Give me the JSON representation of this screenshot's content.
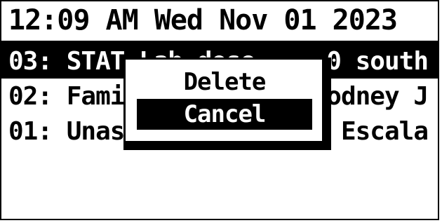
{
  "status": {
    "time": "12:09 AM",
    "date": "Wed Nov 01 2023"
  },
  "rows": [
    {
      "index": "03:",
      "name": "STAT Lab dose",
      "count": "0",
      "right": "south",
      "selected": true
    },
    {
      "index": "02:",
      "name": "Famil",
      "right": "odney J",
      "selected": false
    },
    {
      "index": "01:",
      "name": "Unas",
      "right": "Escala",
      "selected": false
    }
  ],
  "popup": {
    "options": [
      "Delete",
      "Cancel"
    ],
    "highlighted": "Cancel"
  },
  "colors": {
    "foreground": "#000000",
    "background": "#ffffff"
  }
}
